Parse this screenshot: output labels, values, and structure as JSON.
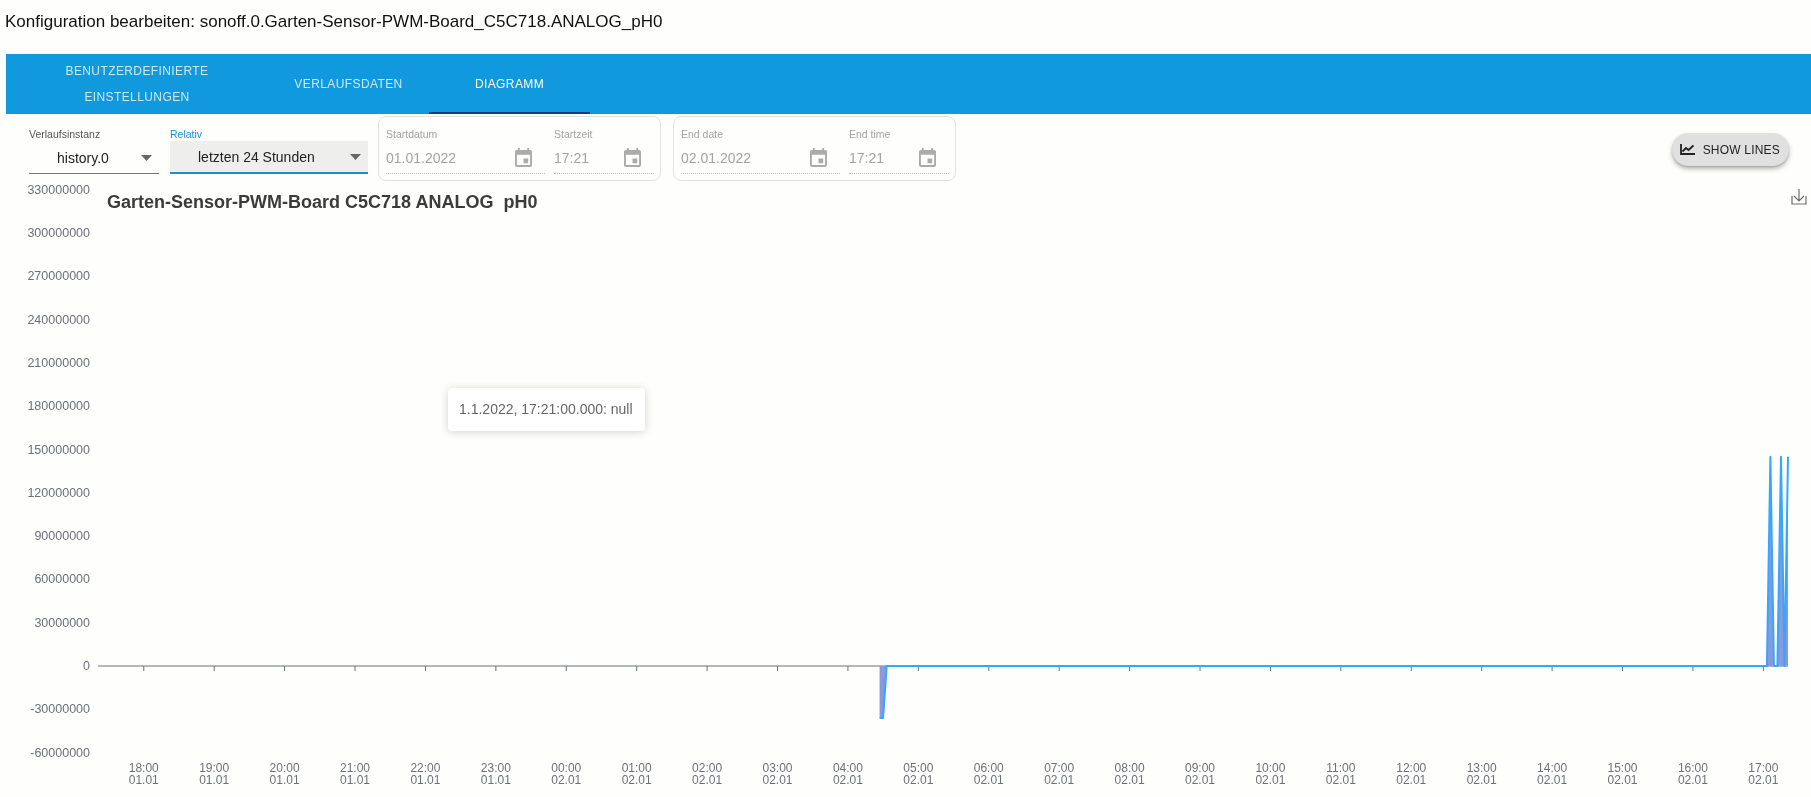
{
  "window": {
    "title": "Konfiguration bearbeiten: sonoff.0.Garten-Sensor-PWM-Board_C5C718.ANALOG_pH0"
  },
  "tabs": [
    {
      "label": "BENUTZERDEFINIERTE EINSTELLUNGEN",
      "selected": false
    },
    {
      "label": "VERLAUFSDATEN",
      "selected": false
    },
    {
      "label": "DIAGRAMM",
      "selected": true
    }
  ],
  "controls": {
    "selects": [
      {
        "label": "Verlaufsinstanz",
        "value": "history.0",
        "focused": false
      },
      {
        "label": "Relativ",
        "value": "letzten 24 Stunden",
        "focused": true
      }
    ],
    "ranges": [
      {
        "fields": [
          {
            "kind": "date",
            "label": "Startdatum",
            "value": "01.01.2022",
            "disabled": true
          },
          {
            "kind": "time",
            "label": "Startzeit",
            "value": "17:21",
            "disabled": true
          }
        ]
      },
      {
        "fields": [
          {
            "kind": "date",
            "label": "End date",
            "value": "02.01.2022",
            "disabled": true
          },
          {
            "kind": "time",
            "label": "End time",
            "value": "17:21",
            "disabled": true
          }
        ]
      }
    ],
    "show_lines_button": "SHOW LINES"
  },
  "chart": {
    "tooltip": "1.1.2022, 17:21:00.000: null",
    "chart_data": {
      "type": "area",
      "title": "Garten-Sensor-PWM-Board C5C718 ANALOG  pH0",
      "categories": [
        null,
        null,
        null,
        null,
        null,
        null,
        null,
        null,
        null,
        null,
        null,
        null,
        null,
        "18:00\n01.01",
        null,
        null,
        null,
        null,
        null,
        null,
        null,
        null,
        null,
        null,
        null,
        null,
        null,
        null,
        null,
        null,
        null,
        null,
        null,
        "19:00\n01.01",
        null,
        null,
        null,
        null,
        null,
        null,
        null,
        null,
        null,
        null,
        null,
        null,
        null,
        null,
        null,
        null,
        null,
        null,
        null,
        "20:00\n01.01",
        null,
        null,
        null,
        null,
        null,
        null,
        null,
        null,
        null,
        null,
        null,
        null,
        null,
        null,
        null,
        null,
        null,
        null,
        null,
        "21:00\n01.01",
        null,
        null,
        null,
        null,
        null,
        null,
        null,
        null,
        null,
        null,
        null,
        null,
        null,
        null,
        null,
        null,
        null,
        null,
        null,
        "22:00\n01.01",
        null,
        null,
        null,
        null,
        null,
        null,
        null,
        null,
        null,
        null,
        null,
        null,
        null,
        null,
        null,
        null,
        null,
        null,
        null,
        "23:00\n01.01",
        null,
        null,
        null,
        null,
        null,
        null,
        null,
        null,
        null,
        null,
        null,
        null,
        null,
        null,
        null,
        null,
        null,
        null,
        null,
        "00:00\n02.01",
        null,
        null,
        null,
        null,
        null,
        null,
        null,
        null,
        null,
        null,
        null,
        null,
        null,
        null,
        null,
        null,
        null,
        null,
        null,
        "01:00\n02.01",
        null,
        null,
        null,
        null,
        null,
        null,
        null,
        null,
        null,
        null,
        null,
        null,
        null,
        null,
        null,
        null,
        null,
        null,
        null,
        "02:00\n02.01",
        null,
        null,
        null,
        null,
        null,
        null,
        null,
        null,
        null,
        null,
        null,
        null,
        null,
        null,
        null,
        null,
        null,
        null,
        null,
        "03:00\n02.01",
        null,
        null,
        null,
        null,
        null,
        null,
        null,
        null,
        null,
        null,
        null,
        null,
        null,
        null,
        null,
        null,
        null,
        null,
        null,
        "04:00\n02.01",
        null,
        null,
        null,
        null,
        null,
        null,
        null,
        null,
        null,
        null,
        null,
        null,
        null,
        null,
        null,
        null,
        null,
        null,
        null,
        "05:00\n02.01",
        null,
        null,
        null,
        null,
        null,
        null,
        null,
        null,
        null,
        null,
        null,
        null,
        null,
        null,
        null,
        null,
        null,
        null,
        null,
        "06:00\n02.01",
        null,
        null,
        null,
        null,
        null,
        null,
        null,
        null,
        null,
        null,
        null,
        null,
        null,
        null,
        null,
        null,
        null,
        null,
        null,
        "07:00\n02.01",
        null,
        null,
        null,
        null,
        null,
        null,
        null,
        null,
        null,
        null,
        null,
        null,
        null,
        null,
        null,
        null,
        null,
        null,
        null,
        "08:00\n02.01",
        null,
        null,
        null,
        null,
        null,
        null,
        null,
        null,
        null,
        null,
        null,
        null,
        null,
        null,
        null,
        null,
        null,
        null,
        null,
        "09:00\n02.01",
        null,
        null,
        null,
        null,
        null,
        null,
        null,
        null,
        null,
        null,
        null,
        null,
        null,
        null,
        null,
        null,
        null,
        null,
        null,
        "10:00\n02.01",
        null,
        null,
        null,
        null,
        null,
        null,
        null,
        null,
        null,
        null,
        null,
        null,
        null,
        null,
        null,
        null,
        null,
        null,
        null,
        "11:00\n02.01",
        null,
        null,
        null,
        null,
        null,
        null,
        null,
        null,
        null,
        null,
        null,
        null,
        null,
        null,
        null,
        null,
        null,
        null,
        null,
        "12:00\n02.01",
        null,
        null,
        null,
        null,
        null,
        null,
        null,
        null,
        null,
        null,
        null,
        null,
        null,
        null,
        null,
        null,
        null,
        null,
        null,
        "13:00\n02.01",
        null,
        null,
        null,
        null,
        null,
        null,
        null,
        null,
        null,
        null,
        null,
        null,
        null,
        null,
        null,
        null,
        null,
        null,
        null,
        "14:00\n02.01",
        null,
        null,
        null,
        null,
        null,
        null,
        null,
        null,
        null,
        null,
        null,
        null,
        null,
        null,
        null,
        null,
        null,
        null,
        null,
        "15:00\n02.01",
        null,
        null,
        null,
        null,
        null,
        null,
        null,
        null,
        null,
        null,
        null,
        null,
        null,
        null,
        null,
        null,
        null,
        null,
        null,
        "16:00\n02.01",
        null,
        null,
        null,
        null,
        null,
        null,
        null,
        null,
        null,
        null,
        null,
        null,
        null,
        null,
        null,
        null,
        null,
        null,
        null,
        "17:00\n02.01",
        null,
        null,
        null,
        null,
        null,
        null,
        null
      ],
      "values": [
        null,
        null,
        null,
        null,
        null,
        null,
        null,
        null,
        null,
        null,
        null,
        null,
        null,
        null,
        null,
        null,
        null,
        null,
        null,
        null,
        null,
        null,
        null,
        null,
        null,
        null,
        null,
        null,
        null,
        null,
        null,
        null,
        null,
        null,
        null,
        null,
        null,
        null,
        null,
        null,
        null,
        null,
        null,
        null,
        null,
        null,
        null,
        null,
        null,
        null,
        null,
        null,
        null,
        null,
        null,
        null,
        null,
        null,
        null,
        null,
        null,
        null,
        null,
        null,
        null,
        null,
        null,
        null,
        null,
        null,
        null,
        null,
        null,
        null,
        null,
        null,
        null,
        null,
        null,
        null,
        null,
        null,
        null,
        null,
        null,
        null,
        null,
        null,
        null,
        null,
        null,
        null,
        null,
        null,
        null,
        null,
        null,
        null,
        null,
        null,
        null,
        null,
        null,
        null,
        null,
        null,
        null,
        null,
        null,
        null,
        null,
        null,
        null,
        null,
        null,
        null,
        null,
        null,
        null,
        null,
        null,
        null,
        null,
        null,
        null,
        null,
        null,
        null,
        null,
        null,
        null,
        null,
        null,
        null,
        null,
        null,
        null,
        null,
        null,
        null,
        null,
        null,
        null,
        null,
        null,
        null,
        null,
        null,
        null,
        null,
        null,
        null,
        null,
        null,
        null,
        null,
        null,
        null,
        null,
        null,
        null,
        null,
        null,
        null,
        null,
        null,
        null,
        null,
        null,
        null,
        null,
        null,
        null,
        null,
        null,
        null,
        null,
        null,
        null,
        null,
        null,
        null,
        null,
        null,
        null,
        null,
        null,
        null,
        null,
        null,
        null,
        null,
        null,
        null,
        null,
        null,
        null,
        null,
        null,
        null,
        null,
        null,
        null,
        null,
        null,
        null,
        null,
        null,
        null,
        null,
        null,
        null,
        null,
        null,
        null,
        null,
        null,
        null,
        null,
        null,
        null,
        null,
        -36000000,
        -36000000,
        0,
        0,
        0,
        0,
        0,
        0,
        0,
        0,
        0,
        0,
        0,
        0,
        0,
        0,
        0,
        0,
        0,
        0,
        0,
        0,
        0,
        0,
        0,
        0,
        0,
        0,
        0,
        0,
        0,
        0,
        0,
        0,
        0,
        0,
        0,
        0,
        0,
        0,
        0,
        0,
        0,
        0,
        0,
        0,
        0,
        0,
        0,
        0,
        0,
        0,
        0,
        0,
        0,
        0,
        0,
        0,
        0,
        0,
        0,
        0,
        0,
        0,
        0,
        0,
        0,
        0,
        0,
        0,
        0,
        0,
        0,
        0,
        0,
        0,
        0,
        0,
        0,
        0,
        0,
        0,
        0,
        0,
        0,
        0,
        0,
        0,
        0,
        0,
        0,
        0,
        0,
        0,
        0,
        0,
        0,
        0,
        0,
        0,
        0,
        0,
        0,
        0,
        0,
        0,
        0,
        0,
        0,
        0,
        0,
        0,
        0,
        0,
        0,
        0,
        0,
        0,
        0,
        0,
        0,
        0,
        0,
        0,
        0,
        0,
        0,
        0,
        0,
        0,
        0,
        0,
        0,
        0,
        0,
        0,
        0,
        0,
        0,
        0,
        0,
        0,
        0,
        0,
        0,
        0,
        0,
        0,
        0,
        0,
        0,
        0,
        0,
        0,
        0,
        0,
        0,
        0,
        0,
        0,
        0,
        0,
        0,
        0,
        0,
        0,
        0,
        0,
        0,
        0,
        0,
        0,
        0,
        0,
        0,
        0,
        0,
        0,
        0,
        0,
        0,
        0,
        0,
        0,
        0,
        0,
        0,
        0,
        0,
        0,
        0,
        0,
        0,
        0,
        0,
        0,
        0,
        0,
        0,
        0,
        0,
        0,
        0,
        0,
        0,
        0,
        0,
        0,
        0,
        0,
        0,
        0,
        0,
        0,
        0,
        0,
        0,
        0,
        0,
        0,
        0,
        0,
        0,
        0,
        0,
        0,
        0,
        0,
        0,
        0,
        0,
        0,
        0,
        0,
        0,
        0,
        0,
        0,
        0,
        0,
        0,
        0,
        0,
        0,
        0,
        0,
        0,
        0,
        0,
        0,
        0,
        0,
        0,
        145000000,
        0,
        0,
        145000000,
        0,
        145000000
      ],
      "ylim": [
        -60000000,
        330000000
      ],
      "yticks": [
        330000000,
        300000000,
        270000000,
        240000000,
        210000000,
        180000000,
        150000000,
        120000000,
        90000000,
        60000000,
        30000000,
        0,
        -30000000,
        -60000000
      ]
    }
  }
}
